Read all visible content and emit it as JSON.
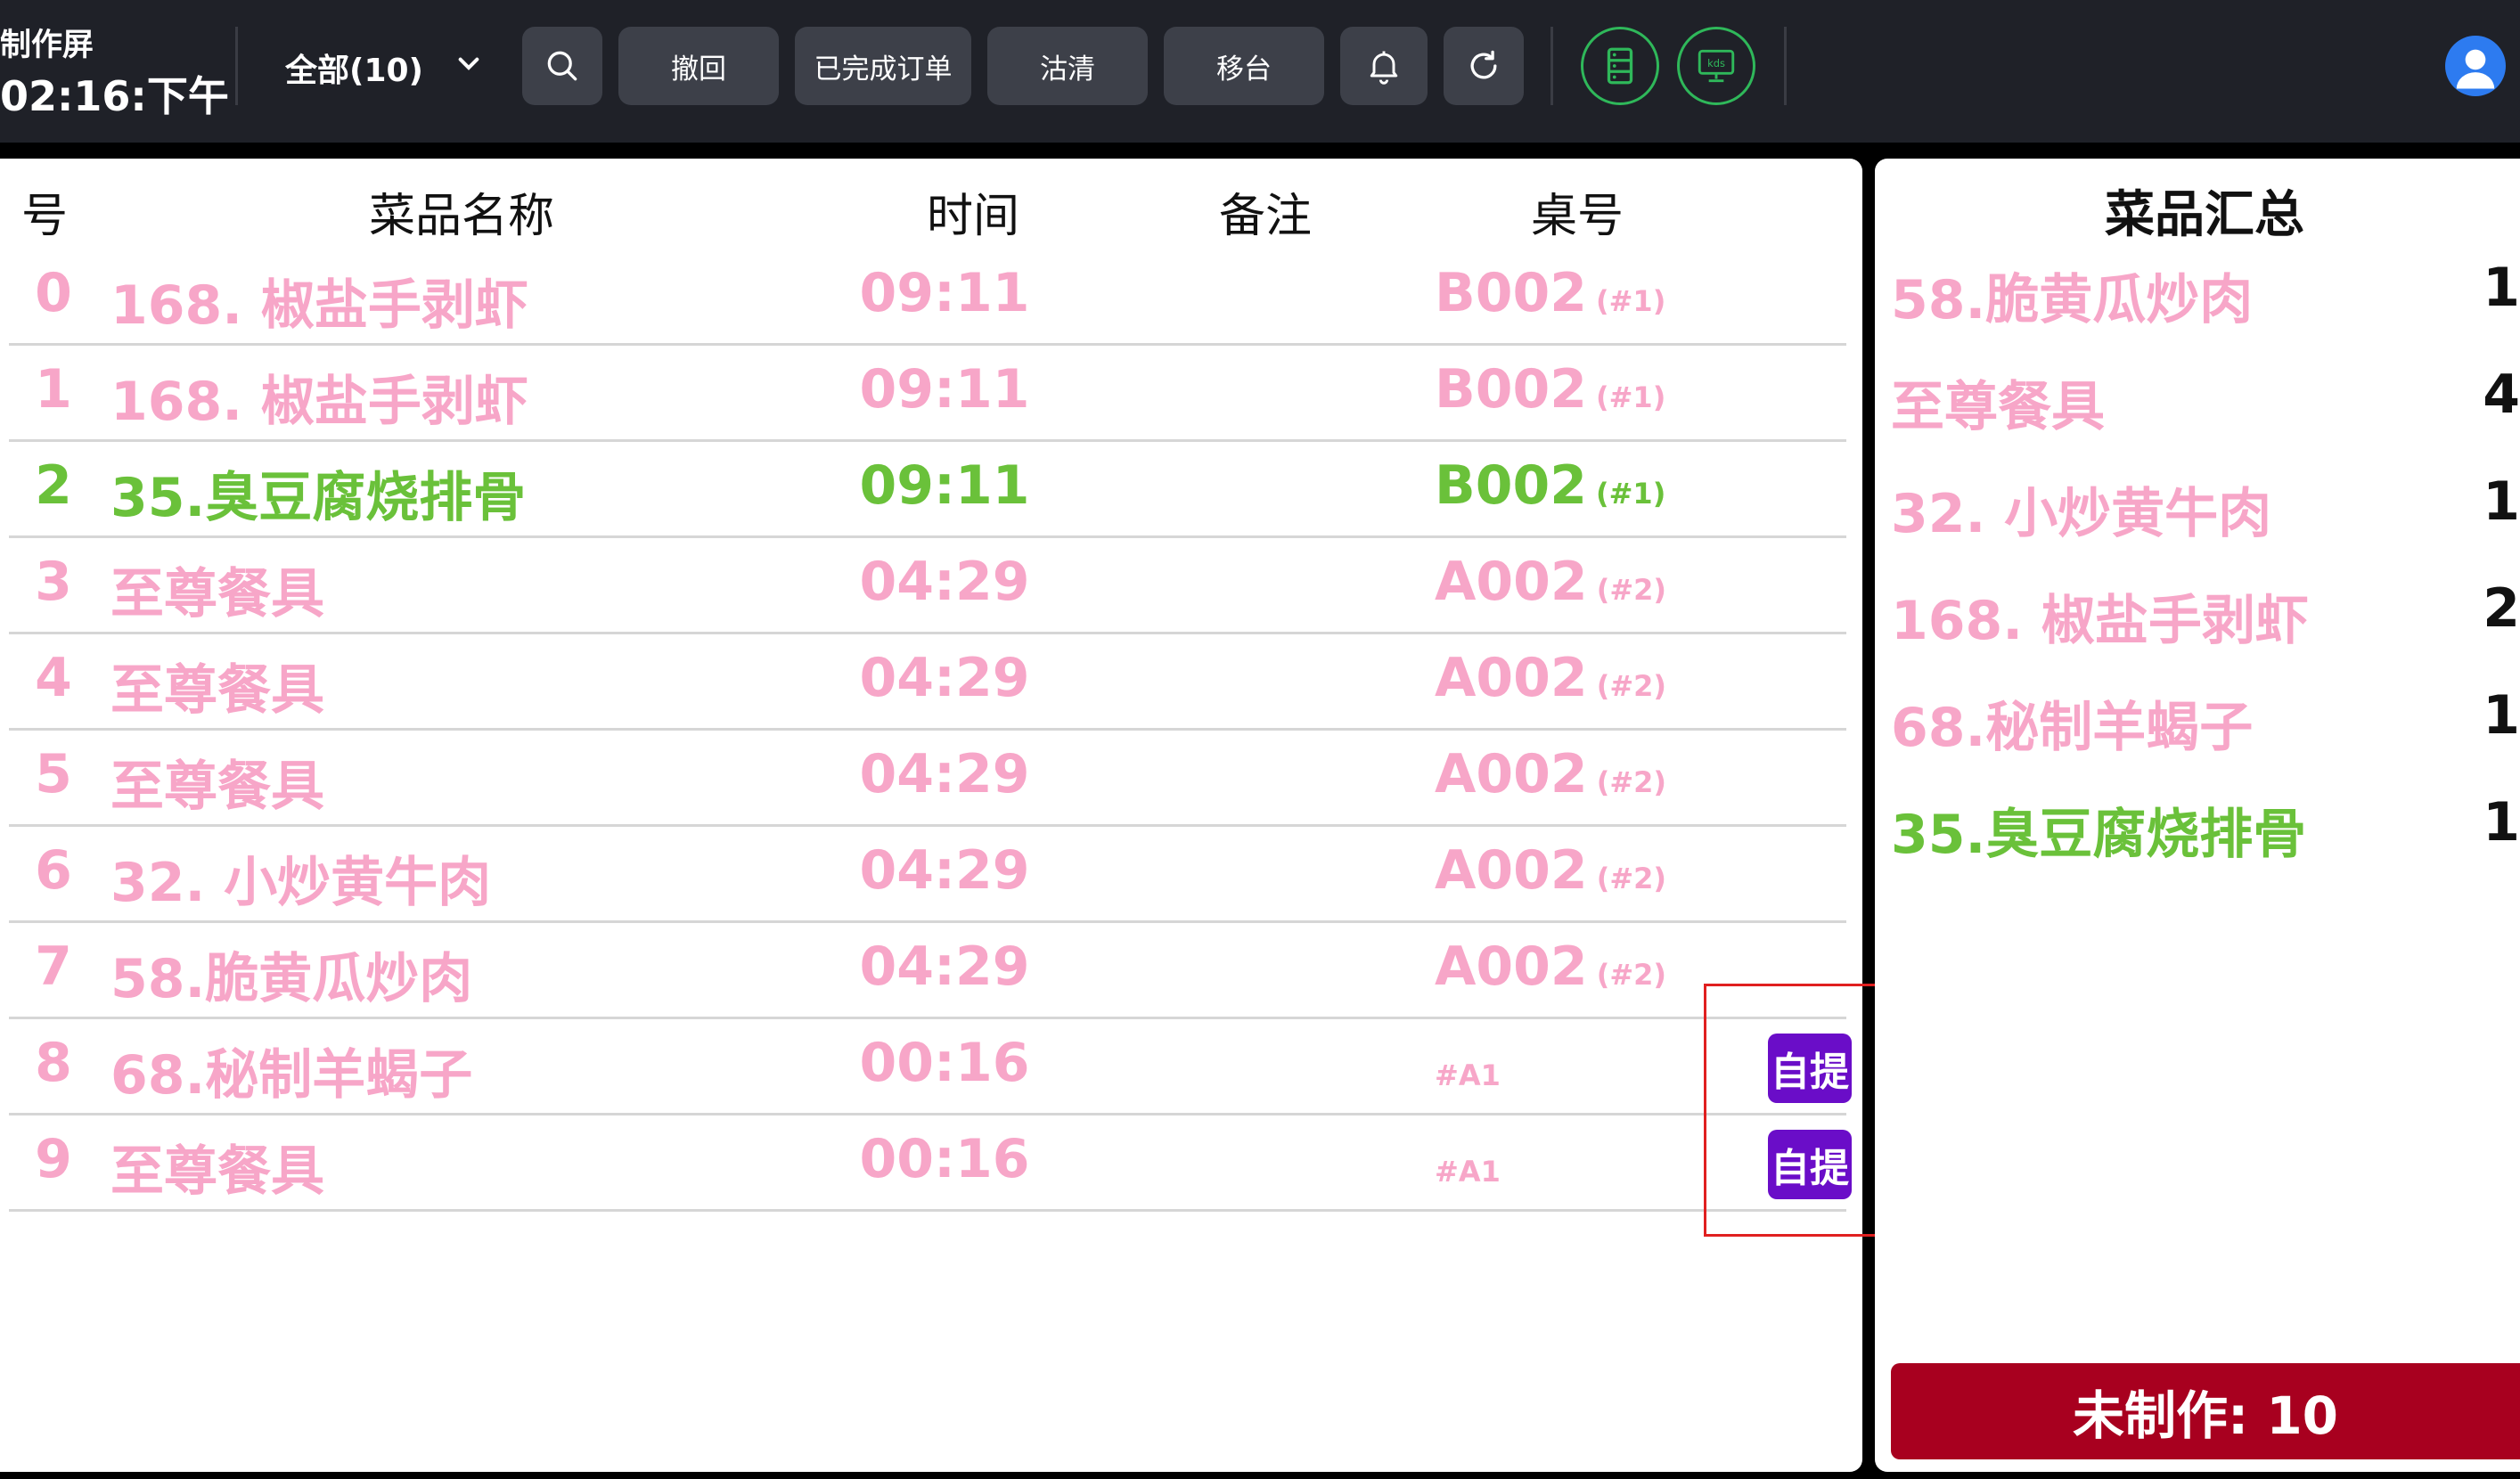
{
  "header": {
    "title": "制作屏",
    "clock": "02:16:下午",
    "filter_label": "全部(10)",
    "buttons": {
      "undo": "撤回",
      "completed": "已完成订单",
      "clear": "沽清",
      "move": "移台"
    },
    "icons": {
      "search": "search-icon",
      "bell": "bell-icon",
      "refresh": "refresh-icon",
      "list": "list-icon",
      "kds": "kds-icon",
      "user": "user-icon"
    },
    "kds_text": "kds"
  },
  "colors": {
    "pink": "#f7a6c8",
    "green": "#6ac13a",
    "pickup_bg": "#6a0dc8",
    "pending_bg": "#a8001f",
    "accent": "#2d7bf0"
  },
  "columns": {
    "idx": "号",
    "name": "菜品名称",
    "time": "时间",
    "note": "备注",
    "table": "桌号"
  },
  "orders": [
    {
      "idx": "0",
      "name": "168. 椒盐手剥虾",
      "time": "09:11",
      "note": "",
      "table": "B002",
      "seat": "(#1)",
      "color": "#f7a6c8"
    },
    {
      "idx": "1",
      "name": "168. 椒盐手剥虾",
      "time": "09:11",
      "note": "",
      "table": "B002",
      "seat": "(#1)",
      "color": "#f7a6c8"
    },
    {
      "idx": "2",
      "name": "35.臭豆腐烧排骨",
      "time": "09:11",
      "note": "",
      "table": "B002",
      "seat": "(#1)",
      "color": "#6ac13a"
    },
    {
      "idx": "3",
      "name": "至尊餐具",
      "time": "04:29",
      "note": "",
      "table": "A002",
      "seat": "(#2)",
      "color": "#f7a6c8"
    },
    {
      "idx": "4",
      "name": "至尊餐具",
      "time": "04:29",
      "note": "",
      "table": "A002",
      "seat": "(#2)",
      "color": "#f7a6c8"
    },
    {
      "idx": "5",
      "name": "至尊餐具",
      "time": "04:29",
      "note": "",
      "table": "A002",
      "seat": "(#2)",
      "color": "#f7a6c8"
    },
    {
      "idx": "6",
      "name": "32. 小炒黄牛肉",
      "time": "04:29",
      "note": "",
      "table": "A002",
      "seat": "(#2)",
      "color": "#f7a6c8"
    },
    {
      "idx": "7",
      "name": "58.脆黄瓜炒肉",
      "time": "04:29",
      "note": "",
      "table": "A002",
      "seat": "(#2)",
      "color": "#f7a6c8"
    },
    {
      "idx": "8",
      "name": "68.秘制羊蝎子",
      "time": "00:16",
      "note": "",
      "table": "#A1",
      "seat": "",
      "color": "#f7a6c8",
      "badge": "自提"
    },
    {
      "idx": "9",
      "name": "至尊餐具",
      "time": "00:16",
      "note": "",
      "table": "#A1",
      "seat": "",
      "color": "#f7a6c8",
      "badge": "自提"
    }
  ],
  "summary": {
    "title": "菜品汇总",
    "items": [
      {
        "name": "58.脆黄瓜炒肉",
        "qty": "1",
        "color": "#f7a6c8"
      },
      {
        "name": "至尊餐具",
        "qty": "4",
        "color": "#f7a6c8"
      },
      {
        "name": "32. 小炒黄牛肉",
        "qty": "1",
        "color": "#f7a6c8"
      },
      {
        "name": "168. 椒盐手剥虾",
        "qty": "2",
        "color": "#f7a6c8"
      },
      {
        "name": "68.秘制羊蝎子",
        "qty": "1",
        "color": "#f7a6c8"
      },
      {
        "name": "35.臭豆腐烧排骨",
        "qty": "1",
        "color": "#6ac13a"
      }
    ],
    "pending": "未制作: 10"
  }
}
